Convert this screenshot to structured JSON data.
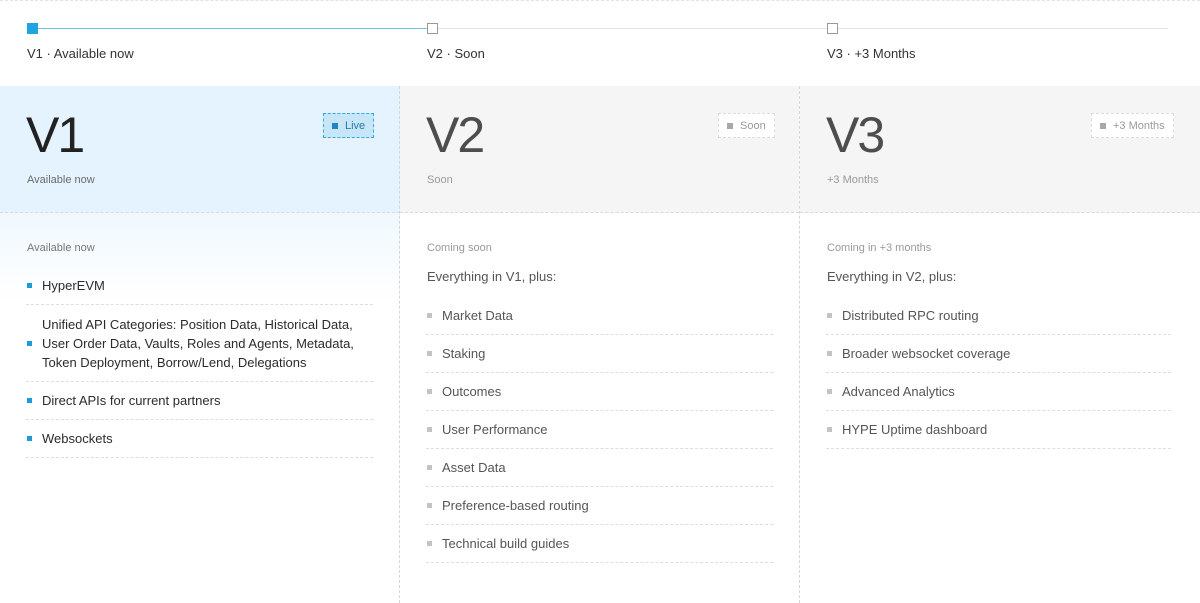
{
  "timeline": {
    "steps": [
      {
        "label": "V1 · Available now",
        "active": true
      },
      {
        "label": "V2 · Soon",
        "active": false
      },
      {
        "label": "V3 · +3 Months",
        "active": false
      }
    ]
  },
  "columns": [
    {
      "version": "V1",
      "status": "Available now",
      "badge": "Live",
      "section_label": "Available now",
      "items": [
        "HyperEVM",
        "Unified API Categories: Position Data, Historical Data, User Order Data, Vaults, Roles and Agents, Metadata, Token Deployment, Borrow/Lend, Delegations",
        "Direct APIs for current partners",
        "Websockets"
      ]
    },
    {
      "version": "V2",
      "status": "Soon",
      "badge": "Soon",
      "section_label": "Coming soon",
      "intro": "Everything in V1, plus:",
      "items": [
        "Market Data",
        "Staking",
        "Outcomes",
        "User Performance",
        "Asset Data",
        "Preference-based routing",
        "Technical build guides"
      ]
    },
    {
      "version": "V3",
      "status": "+3 Months",
      "badge": "+3 Months",
      "section_label": "Coming in +3 months",
      "intro": "Everything in V2, plus:",
      "items": [
        "Distributed RPC routing",
        "Broader websocket coverage",
        "Advanced Analytics",
        "HYPE Uptime dashboard"
      ]
    }
  ],
  "colors": {
    "accent": "#1ea5df",
    "v1_header_bg": "#e4f3fd",
    "muted_header_bg": "#f5f5f5",
    "progress_line": "#6cc6ea"
  }
}
